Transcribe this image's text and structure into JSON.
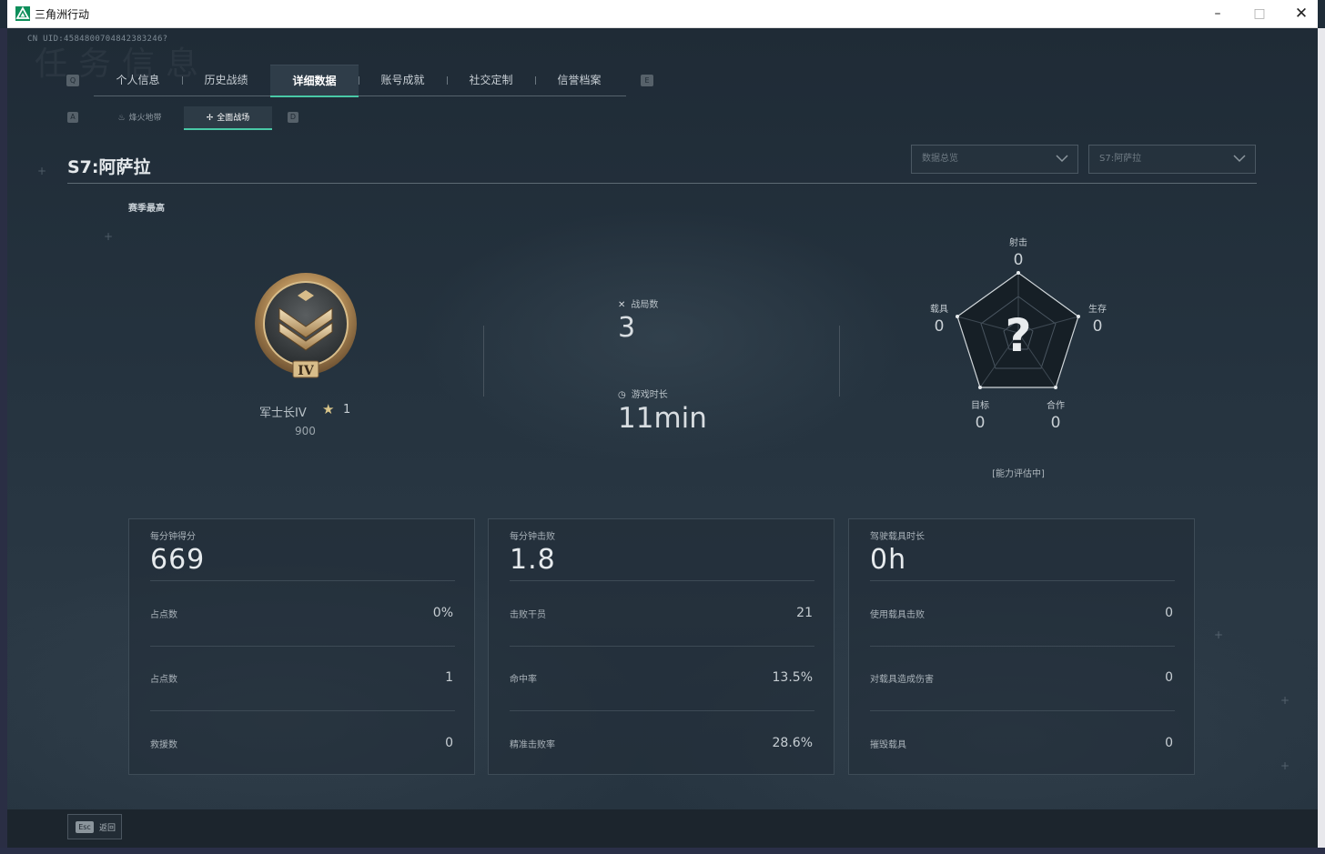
{
  "window": {
    "title": "三角洲行动",
    "minimize": "–",
    "maximize": "□",
    "close": "✕"
  },
  "uid": "CN UID:4584800704842383246?",
  "watermark": "任务信息",
  "tabs": {
    "prev_key": "Q",
    "next_key": "E",
    "items": [
      "个人信息",
      "历史战绩",
      "详细数据",
      "账号成就",
      "社交定制",
      "信誉档案"
    ],
    "active_index": 2
  },
  "subtabs": {
    "prev_key": "A",
    "next_key": "D",
    "items": [
      {
        "label": "烽火地带",
        "icon": "flame-icon"
      },
      {
        "label": "全面战场",
        "icon": "battlefield-icon"
      }
    ],
    "active_index": 1
  },
  "season": {
    "title": "S7:阿萨拉"
  },
  "dropdowns": [
    {
      "value": "数据总览"
    },
    {
      "value": "S7:阿萨拉"
    }
  ],
  "season_best": "赛季最高",
  "rank": {
    "name": "军士长IV",
    "numeral": "IV",
    "star_count": "1",
    "score": "900"
  },
  "summary": {
    "matches_label": "战局数",
    "matches_value": "3",
    "playtime_label": "游戏时长",
    "playtime_value": "11min"
  },
  "radar": {
    "axes": [
      {
        "label": "射击",
        "value": "0"
      },
      {
        "label": "生存",
        "value": "0"
      },
      {
        "label": "合作",
        "value": "0"
      },
      {
        "label": "目标",
        "value": "0"
      },
      {
        "label": "载具",
        "value": "0"
      }
    ],
    "center": "?",
    "note": "[能力评估中]"
  },
  "panels": [
    {
      "title": "每分钟得分",
      "value": "669",
      "rows": [
        {
          "label": "占点数",
          "value": "0%"
        },
        {
          "label": "占点数",
          "value": "1"
        },
        {
          "label": "救援数",
          "value": "0"
        }
      ]
    },
    {
      "title": "每分钟击败",
      "value": "1.8",
      "rows": [
        {
          "label": "击败干员",
          "value": "21"
        },
        {
          "label": "命中率",
          "value": "13.5%"
        },
        {
          "label": "精准击败率",
          "value": "28.6%"
        }
      ]
    },
    {
      "title": "驾驶载具时长",
      "value": "0h",
      "rows": [
        {
          "label": "使用载具击败",
          "value": "0"
        },
        {
          "label": "对载具造成伤害",
          "value": "0"
        },
        {
          "label": "摧毁载具",
          "value": "0"
        }
      ]
    }
  ],
  "footer": {
    "esc_key": "Esc",
    "esc_label": "返回"
  },
  "colors": {
    "accent": "#49c8a6",
    "background": "#1f2c38",
    "rank_gold": "#c9a56a"
  }
}
